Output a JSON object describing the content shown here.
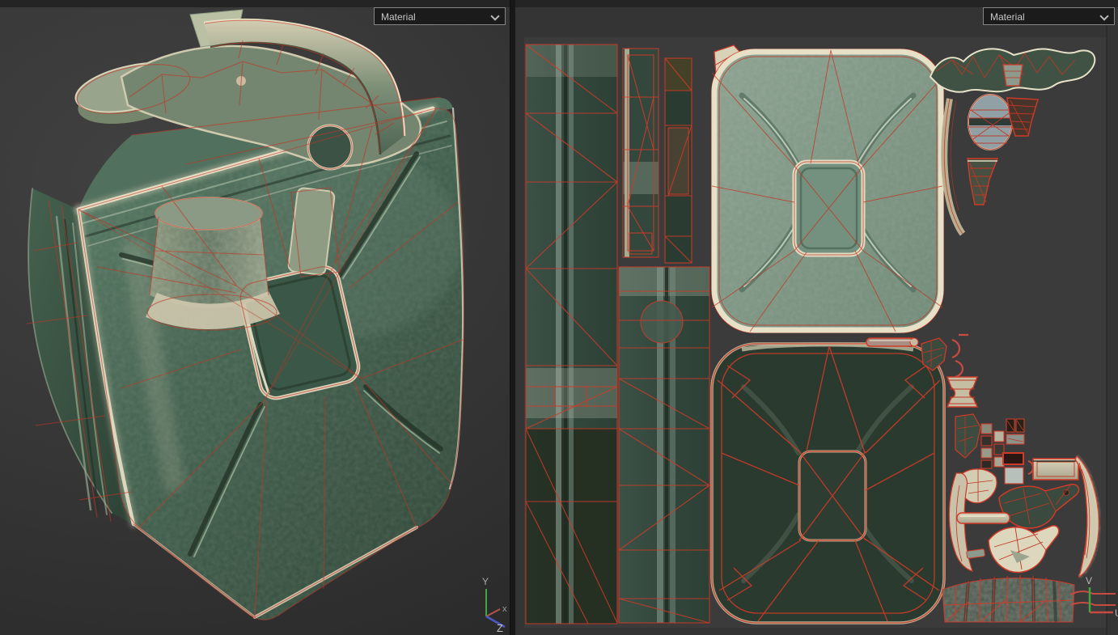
{
  "panels": {
    "left": {
      "label": "3d-model-viewport",
      "dropdown": {
        "value": "Material"
      },
      "gizmo": {
        "y": "Y",
        "x": "x",
        "z": "Z"
      }
    },
    "right": {
      "label": "uv-editor-viewport",
      "dropdown": {
        "value": "Material"
      },
      "gizmo": {
        "v": "V",
        "u": "U"
      }
    }
  },
  "icons": {
    "dropdown_chevron": "chevron-down"
  },
  "colors": {
    "wireframe": "#c23525",
    "uv_edge": "#d03a28",
    "can_green": "#44604f",
    "worn_metal": "#e2dbc1",
    "viewport_bg": "#363636",
    "uv_tile_bg": "#3b3b3b",
    "top_strip": "#242424",
    "dropdown_bg": "#1b1b1b",
    "dropdown_border": "#858585",
    "axis_x": "#b5544a",
    "axis_y": "#3fa63f",
    "axis_z": "#5058c8"
  }
}
